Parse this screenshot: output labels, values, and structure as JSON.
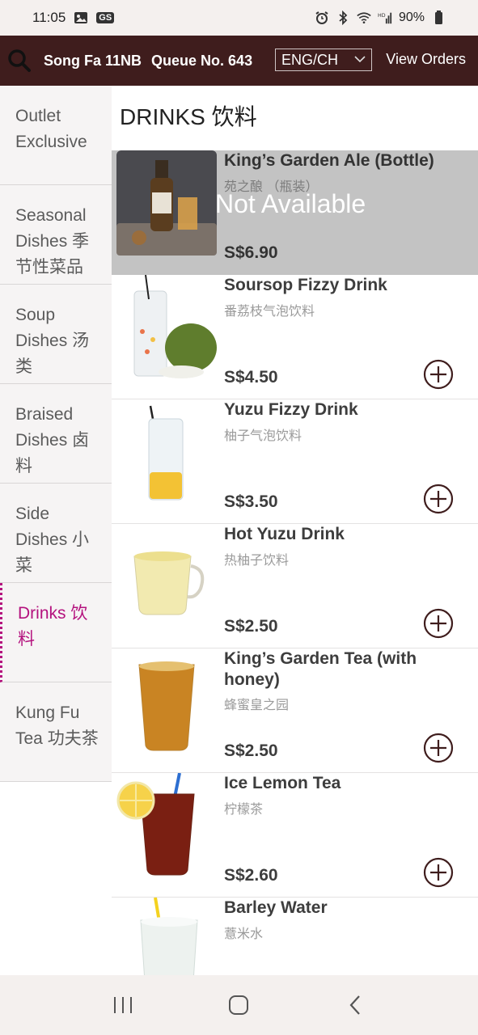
{
  "status_bar": {
    "time": "11:05",
    "gs_badge": "GS",
    "battery": "90%",
    "icons": [
      "image-icon",
      "alarm-icon",
      "bluetooth-icon",
      "wifi-icon",
      "signal-icon",
      "battery-icon"
    ]
  },
  "header": {
    "store": "Song Fa 11NB",
    "queue": "Queue No. 643",
    "language": "ENG/CH",
    "view_orders": "View Orders",
    "bg_color": "#3f1d1d"
  },
  "sidebar": {
    "active_color": "#b4127e",
    "items": [
      {
        "label": "Outlet Exclusive"
      },
      {
        "label": "Seasonal Dishes 季节性菜品"
      },
      {
        "label": "Soup Dishes 汤类"
      },
      {
        "label": "Braised Dishes 卤料"
      },
      {
        "label": "Side Dishes 小菜"
      },
      {
        "label": "Drinks 饮料"
      },
      {
        "label": "Kung Fu Tea 功夫茶"
      }
    ]
  },
  "section": {
    "title": "DRINKS 饮料"
  },
  "products": [
    {
      "name": "King’s Garden Ale (Bottle)",
      "cn": "苑之酿 （瓶装）",
      "price": "S$6.90",
      "status": "Not Available"
    },
    {
      "name": "Soursop Fizzy Drink",
      "cn": "番荔枝气泡饮料",
      "price": "S$4.50"
    },
    {
      "name": "Yuzu Fizzy Drink",
      "cn": "柚子气泡饮料",
      "price": "S$3.50"
    },
    {
      "name": "Hot Yuzu Drink",
      "cn": "热柚子饮料",
      "price": "S$2.50"
    },
    {
      "name": "King’s Garden Tea (with honey)",
      "cn": "蜂蜜皇之园",
      "price": "S$2.50"
    },
    {
      "name": "Ice Lemon Tea",
      "cn": "柠檬茶",
      "price": "S$2.60"
    },
    {
      "name": "Barley Water",
      "cn": "薏米水",
      "price": ""
    }
  ]
}
